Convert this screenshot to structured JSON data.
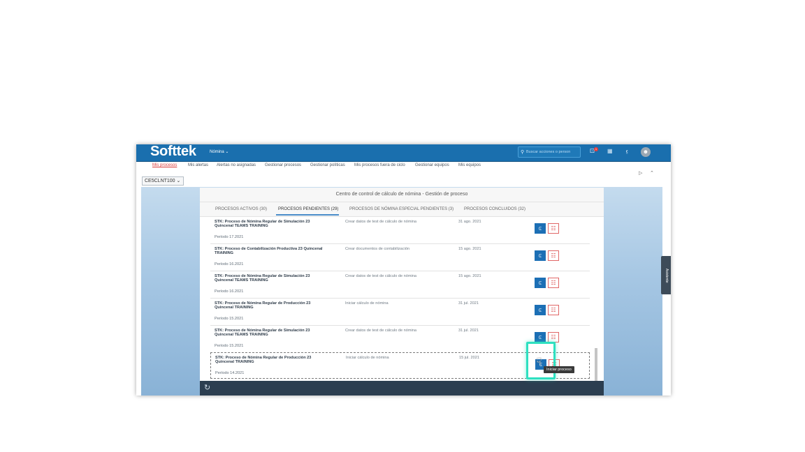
{
  "shell": {
    "logo": "Softtek",
    "app_menu": "Nómina ⌄",
    "search_placeholder": "Buscar acciones o person",
    "notification_count": "1",
    "avatar_initial": "☻"
  },
  "nav": {
    "items": [
      {
        "label": "Mis procesos"
      },
      {
        "label": "Mis alertas"
      },
      {
        "label": "Alertas no asignadas"
      },
      {
        "label": "Gestionar procesos"
      },
      {
        "label": "Gestionar políticas"
      },
      {
        "label": "Mis procesos fuera de ciclo"
      },
      {
        "label": "Gestionar equipos"
      },
      {
        "label": "Mis equipos"
      }
    ]
  },
  "client_select": "CE5CLNT100 ⌄",
  "panel": {
    "title": "Centro de control de cálculo de nómina - Gestión de proceso",
    "tabs": [
      {
        "label": "PROCESOS ACTIVOS (30)"
      },
      {
        "label": "PROCESOS PENDIENTES (29)"
      },
      {
        "label": "PROCESOS DE NÓMINA ESPECIAL PENDIENTES (3)"
      },
      {
        "label": "PROCESOS CONCLUIDOS (32)"
      }
    ],
    "rows": [
      {
        "title": "STK: Proceso de Nómina Regular de Simulación 23 Quincenal TEAMS TRAINING",
        "period": "Período 17.2021",
        "desc": "Crear datos de test de cálculo de nómina",
        "date": "31 ago. 2021"
      },
      {
        "title": "STK: Proceso de Contabilización Productiva 23 Quincenal TRAINING",
        "period": "Período 16.2021",
        "desc": "Crear documentos de contabilización",
        "date": "15 ago. 2021"
      },
      {
        "title": "STK: Proceso de Nómina Regular de Simulación 23 Quincenal TEAMS TRAINING",
        "period": "Período 16.2021",
        "desc": "Crear datos de test de cálculo de nómina",
        "date": "15 ago. 2021"
      },
      {
        "title": "STK: Proceso de Nómina Regular de Producción 23 Quincenal TRAINING",
        "period": "Período 15.2021",
        "desc": "Iniciar cálculo de nómina",
        "date": "31 jul. 2021"
      },
      {
        "title": "STK: Proceso de Nómina Regular de Simulación 23 Quincenal TEAMS TRAINING",
        "period": "Período 15.2021",
        "desc": "Crear datos de test de cálculo de nómina",
        "date": "31 jul. 2021"
      },
      {
        "title": "STK: Proceso de Nómina Regular de Producción 23 Quincenal TRAINING",
        "period": "Período 14.2021",
        "desc": "Iniciar cálculo de nómina",
        "date": "15 jul. 2021"
      }
    ]
  },
  "assist_label": "Asistente",
  "tooltip": "Iniciar proceso",
  "icons": {
    "play": "⏩",
    "delete": "🗑",
    "refresh": "↻",
    "search": "⌕"
  }
}
